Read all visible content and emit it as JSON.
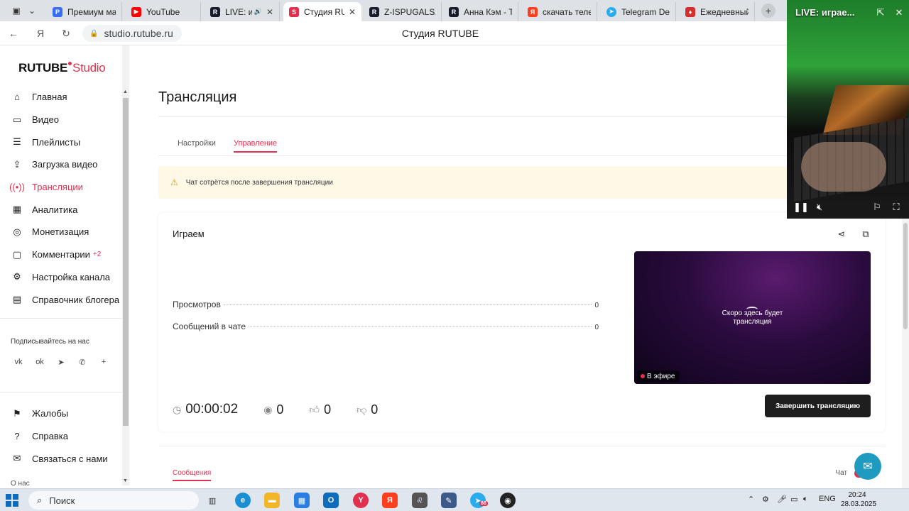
{
  "browser": {
    "tabs": [
      {
        "title": "Премиум мага",
        "icon": "premium-favicon",
        "color": "#3a6df0"
      },
      {
        "title": "YouTube",
        "icon": "youtube-favicon",
        "color": "#ff0000"
      },
      {
        "title": "LIVE: игр",
        "icon": "rutube-favicon",
        "color": "#1a1a2e"
      },
      {
        "title": "Студия RUT",
        "icon": "rutube-studio-favicon",
        "color": "#e3304f",
        "active": true
      },
      {
        "title": "Z-ISPUGALSA",
        "icon": "rutube-favicon",
        "color": "#1a1a2e"
      },
      {
        "title": "Анна Кэм - Те",
        "icon": "rutube-favicon",
        "color": "#1a1a2e"
      },
      {
        "title": "скачать телег",
        "icon": "yandex-favicon",
        "color": "#fc3f1d"
      },
      {
        "title": "Telegram Desk",
        "icon": "telegram-favicon",
        "color": "#2aabee"
      },
      {
        "title": "Ежедневный",
        "icon": "shield-favicon",
        "color": "#d32f2f"
      }
    ],
    "url": "studio.rutube.ru",
    "page_title": "Студия RUTUBE"
  },
  "sidebar": {
    "logo_main": "RUTUBE",
    "logo_studio": "Studio",
    "items": [
      {
        "label": "Главная",
        "icon": "home-icon"
      },
      {
        "label": "Видео",
        "icon": "video-icon"
      },
      {
        "label": "Плейлисты",
        "icon": "playlist-icon"
      },
      {
        "label": "Загрузка видео",
        "icon": "upload-icon"
      },
      {
        "label": "Трансляции",
        "icon": "broadcast-icon",
        "active": true
      },
      {
        "label": "Аналитика",
        "icon": "analytics-icon"
      },
      {
        "label": "Монетизация",
        "icon": "monetization-icon"
      },
      {
        "label": "Комментарии",
        "icon": "comments-icon",
        "badge": "+2"
      },
      {
        "label": "Настройка канала",
        "icon": "channel-settings-icon"
      },
      {
        "label": "Справочник блогера",
        "icon": "blogger-guide-icon"
      }
    ],
    "subscribe_label": "Подписывайтесь на нас",
    "social_icons": [
      "vk-icon",
      "odnoklassniki-icon",
      "telegram-icon",
      "viber-icon",
      "plus-icon"
    ],
    "bottom_items": [
      {
        "label": "Жалобы",
        "icon": "flag-icon"
      },
      {
        "label": "Справка",
        "icon": "help-icon"
      },
      {
        "label": "Связаться с нами",
        "icon": "mail-icon"
      }
    ],
    "about_label": "О нас"
  },
  "main": {
    "page_title": "Трансляция",
    "tabs": [
      {
        "label": "Настройки"
      },
      {
        "label": "Управление",
        "active": true
      }
    ],
    "alert_text": "Чат сотрётся после завершения трансляции",
    "stream": {
      "name": "Играем",
      "stats": [
        {
          "label": "Просмотров",
          "value": "0"
        },
        {
          "label": "Сообщений в чате",
          "value": "0"
        }
      ],
      "elapsed": "00:00:02",
      "viewers": "0",
      "likes": "0",
      "dislikes": "0",
      "preview_text_line1": "Скоро здесь будет",
      "preview_text_line2": "трансляция",
      "live_label": "В эфире",
      "end_button_label": "Завершить трансляцию"
    },
    "lower_tabs": {
      "messages_label": "Сообщения",
      "chat_label": "Чат"
    }
  },
  "pip": {
    "title": "LIVE: играе..."
  },
  "taskbar": {
    "search_label": "Поиск",
    "language": "ENG",
    "time": "20:24",
    "date": "28.03.2025",
    "telegram_badge": "86"
  },
  "colors": {
    "accent": "#e3304f",
    "alert_bg": "#fdf9e6",
    "button_dark": "#1e1e1e"
  }
}
